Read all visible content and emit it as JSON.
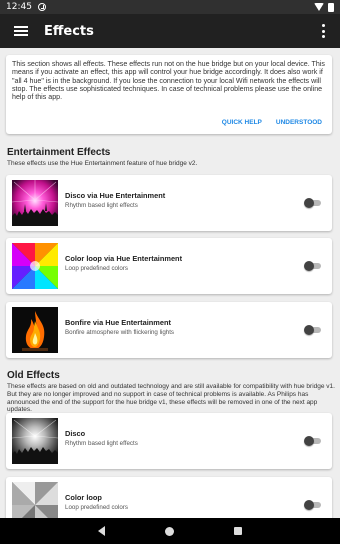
{
  "status_bar": {
    "time": "12:45"
  },
  "app_bar": {
    "title": "Effects",
    "menu_icon": "hamburger-menu-icon",
    "overflow_icon": "more-vert-icon"
  },
  "info": {
    "text": "This section shows all effects. These effects run not on the hue bridge but on your local device. This means if you activate an effect, this app will control your hue bridge accordingly. It does also work if \"all 4 hue\" is in the background. If you lose the connection to your local Wifi network the effects will stop. The effects use sophisticated techniques. In case of technical problems please use the online help of this app.",
    "quick_help": "QUICK HELP",
    "understood": "UNDERSTOOD",
    "accent": "#1e88e5"
  },
  "entertainment": {
    "title": "Entertainment Effects",
    "desc": "These effects use the Hue Entertainment feature of hue bridge v2.",
    "items": [
      {
        "name": "Disco via Hue Entertainment",
        "sub": "Rhythm based light effects",
        "thumb": "disco-color",
        "enabled": false
      },
      {
        "name": "Color loop via Hue Entertainment",
        "sub": "Loop predefined colors",
        "thumb": "color-loop-color",
        "enabled": false
      },
      {
        "name": "Bonfire via Hue Entertainment",
        "sub": "Bonfire atmosphere with flickering lights",
        "thumb": "bonfire",
        "enabled": false
      }
    ]
  },
  "old": {
    "title": "Old Effects",
    "desc": "These effects are based on old and outdated technology and are still available for compatibility with hue bridge v1. But they are no longer improved and no support in case of technical problems is available. As Philips has announced the end of the support for the hue bridge v1, these effects will be removed in one of the next app updates.",
    "items": [
      {
        "name": "Disco",
        "sub": "Rhythm based light effects",
        "thumb": "disco-gray",
        "enabled": false
      },
      {
        "name": "Color loop",
        "sub": "Loop predefined colors",
        "thumb": "color-loop-gray",
        "enabled": false
      }
    ]
  }
}
